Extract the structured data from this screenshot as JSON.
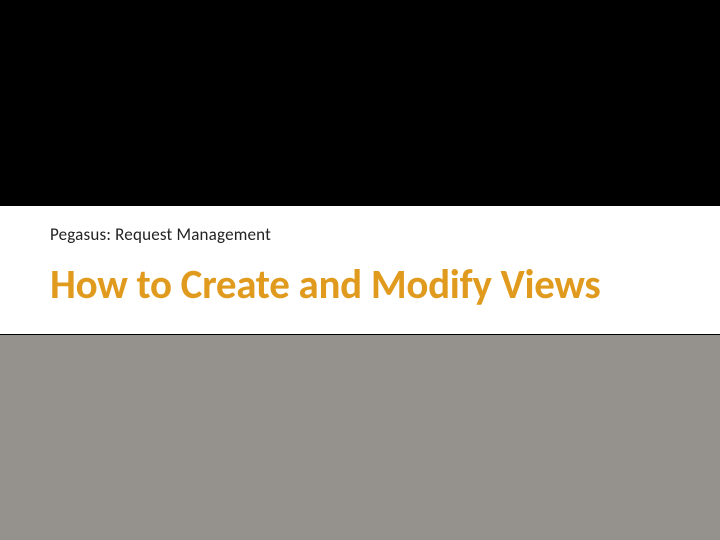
{
  "slide": {
    "subtitle": "Pegasus: Request Management",
    "title": "How to Create and Modify Views"
  }
}
